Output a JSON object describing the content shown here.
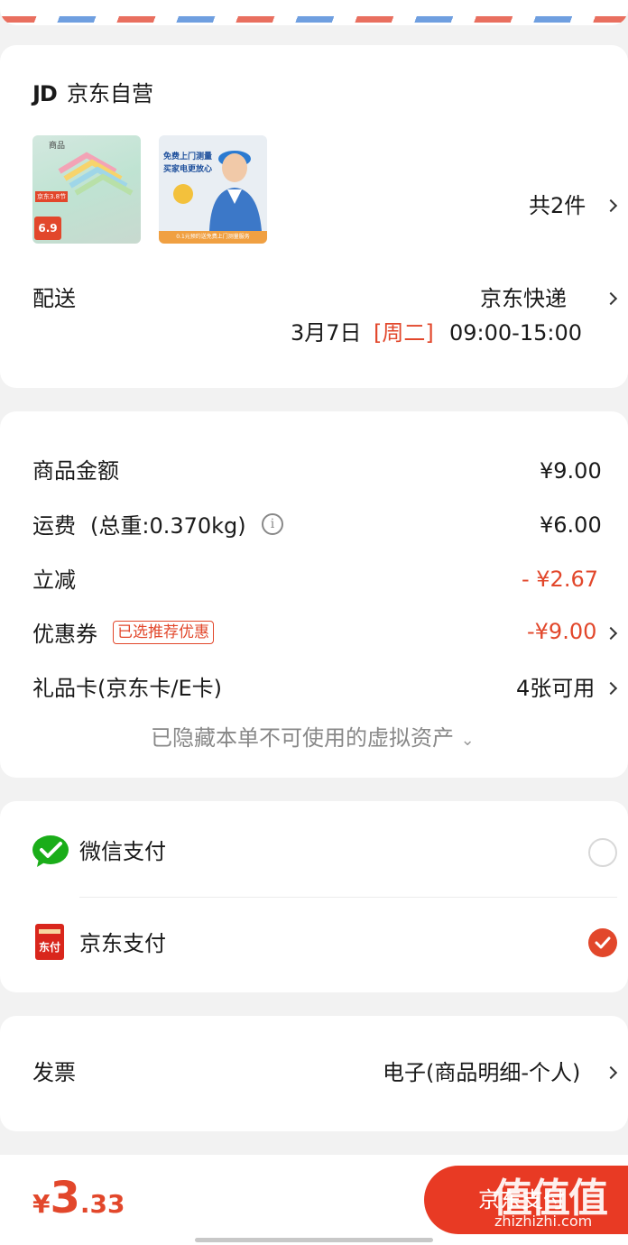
{
  "colors": {
    "accent": "#e2472b",
    "wechat": "#1aad19",
    "page_bg": "#f2f2f2"
  },
  "shop": {
    "logo": "JD",
    "name": "京东自营",
    "products": [
      {
        "title_tag": "商品",
        "promo": "京东3.8节",
        "price": "6.9",
        "icon": "hanger-product-image"
      },
      {
        "banner1": "免费上门测量",
        "banner2": "买家电更放心",
        "footer": "0.1元预约送免费上门测量服务",
        "icon": "installer-service-image"
      }
    ],
    "count_label": "共2件"
  },
  "delivery": {
    "label": "配送",
    "carrier": "京东快递",
    "date": "3月7日",
    "weekday": "[周二]",
    "time": "09:00-15:00"
  },
  "price": {
    "goods_label": "商品金额",
    "goods_value": "¥9.00",
    "freight_label": "运费",
    "freight_weight": "(总重:0.370kg)",
    "freight_value": "¥6.00",
    "discount_label": "立减",
    "discount_value": "- ¥2.67",
    "coupon_label": "优惠券",
    "coupon_badge": "已选推荐优惠",
    "coupon_value": "-¥9.00",
    "giftcard_label": "礼品卡(京东卡/E卡)",
    "giftcard_value": "4张可用",
    "hidden_assets": "已隐藏本单不可使用的虚拟资产"
  },
  "payment": {
    "wechat_label": "微信支付",
    "jd_label": "京东支付",
    "jd_icon_text": "东付",
    "selected": "京东支付"
  },
  "invoice": {
    "label": "发票",
    "value": "电子(商品明细-个人)"
  },
  "footer": {
    "currency": "¥",
    "total_int": "3",
    "total_dec": ".33",
    "pay_button": "京东支付",
    "watermark": "值值值",
    "watermark_url": "zhizhizhi.com"
  }
}
